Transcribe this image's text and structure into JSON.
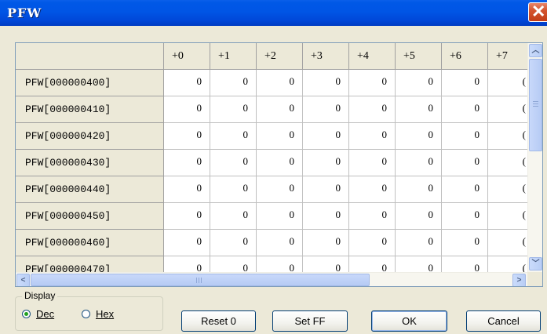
{
  "window": {
    "title": "PFW"
  },
  "grid": {
    "columns": [
      "+0",
      "+1",
      "+2",
      "+3",
      "+4",
      "+5",
      "+6",
      "+7"
    ],
    "rows": [
      {
        "label": "PFW[000000400]",
        "values": [
          "0",
          "0",
          "0",
          "0",
          "0",
          "0",
          "0",
          "("
        ]
      },
      {
        "label": "PFW[000000410]",
        "values": [
          "0",
          "0",
          "0",
          "0",
          "0",
          "0",
          "0",
          "("
        ]
      },
      {
        "label": "PFW[000000420]",
        "values": [
          "0",
          "0",
          "0",
          "0",
          "0",
          "0",
          "0",
          "("
        ]
      },
      {
        "label": "PFW[000000430]",
        "values": [
          "0",
          "0",
          "0",
          "0",
          "0",
          "0",
          "0",
          "("
        ]
      },
      {
        "label": "PFW[000000440]",
        "values": [
          "0",
          "0",
          "0",
          "0",
          "0",
          "0",
          "0",
          "("
        ]
      },
      {
        "label": "PFW[000000450]",
        "values": [
          "0",
          "0",
          "0",
          "0",
          "0",
          "0",
          "0",
          "("
        ]
      },
      {
        "label": "PFW[000000460]",
        "values": [
          "0",
          "0",
          "0",
          "0",
          "0",
          "0",
          "0",
          "("
        ]
      },
      {
        "label": "PFW[000000470]",
        "values": [
          "0",
          "0",
          "0",
          "0",
          "0",
          "0",
          "0",
          "("
        ]
      }
    ]
  },
  "display": {
    "group_label": "Display",
    "dec_label": "Dec",
    "hex_label": "Hex",
    "selected": "Dec"
  },
  "buttons": {
    "reset": "Reset 0",
    "setff": "Set FF",
    "ok": "OK",
    "cancel": "Cancel"
  },
  "icons": {
    "close": "close-icon",
    "scroll_up": "scroll-up-arrow-icon",
    "scroll_down": "scroll-down-arrow-icon",
    "scroll_left": "scroll-left-arrow-icon",
    "scroll_right": "scroll-right-arrow-icon"
  }
}
